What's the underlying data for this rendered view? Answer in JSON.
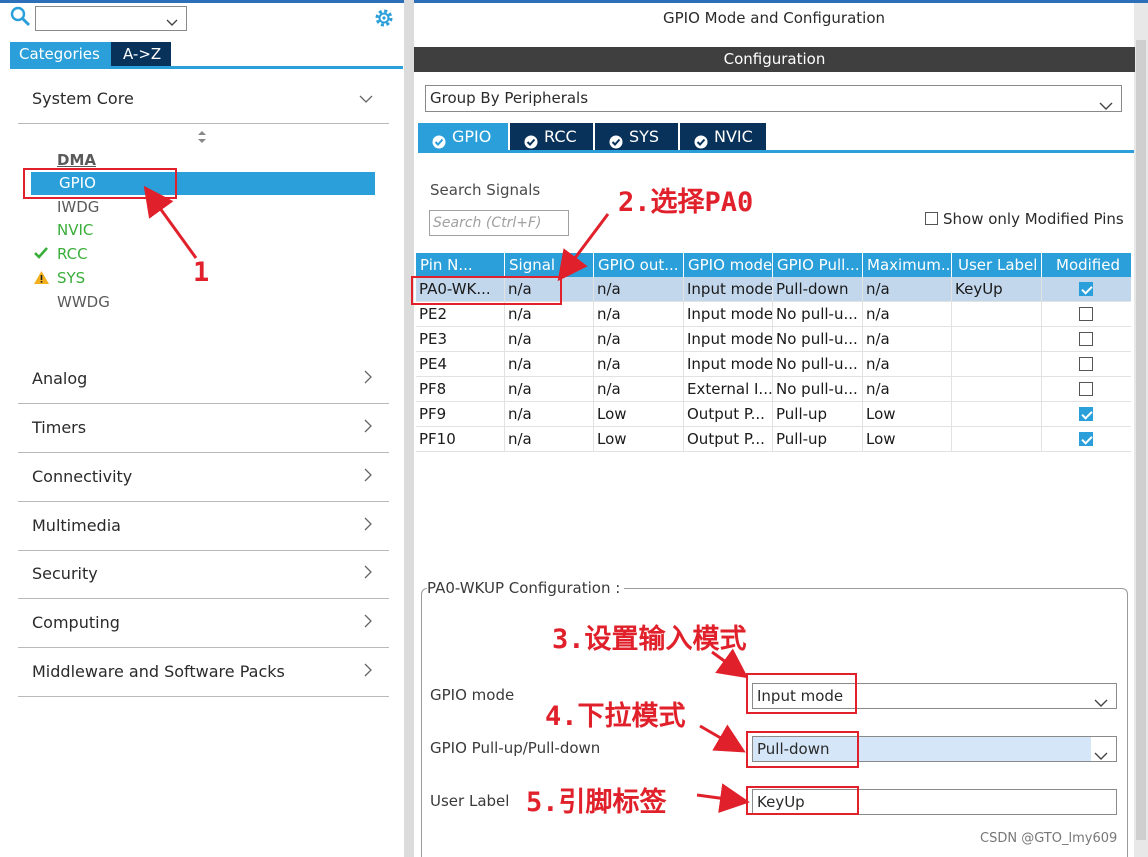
{
  "left": {
    "search_value": "",
    "tabs": [
      "Categories",
      "A->Z"
    ],
    "categories": [
      {
        "label": "System Core",
        "chevron": "chevron-down-icon"
      },
      {
        "label": "Analog",
        "chevron": "chevron-right-icon"
      },
      {
        "label": "Timers",
        "chevron": "chevron-right-icon"
      },
      {
        "label": "Connectivity",
        "chevron": "chevron-right-icon"
      },
      {
        "label": "Multimedia",
        "chevron": "chevron-right-icon"
      },
      {
        "label": "Security",
        "chevron": "chevron-right-icon"
      },
      {
        "label": "Computing",
        "chevron": "chevron-right-icon"
      },
      {
        "label": "Middleware and Software Packs",
        "chevron": "chevron-right-icon"
      }
    ],
    "system_core_items": [
      {
        "label": "DMA",
        "status": "none"
      },
      {
        "label": "GPIO",
        "status": "selected"
      },
      {
        "label": "IWDG",
        "status": "none"
      },
      {
        "label": "NVIC",
        "status": "configured"
      },
      {
        "label": "RCC",
        "status": "check"
      },
      {
        "label": "SYS",
        "status": "warning"
      },
      {
        "label": "WWDG",
        "status": "none"
      }
    ]
  },
  "right": {
    "title": "GPIO Mode and Configuration",
    "config_header": "Configuration",
    "group_by": "Group By Peripherals",
    "tabs": [
      "GPIO",
      "RCC",
      "SYS",
      "NVIC"
    ],
    "active_tab": "GPIO",
    "search_label": "Search Signals",
    "search_placeholder": "Search (Ctrl+F)",
    "show_modified_label": "Show only Modified Pins",
    "show_modified_checked": false,
    "table": {
      "headers": [
        "Pin N...",
        "Signal ...",
        "GPIO out...",
        "GPIO mode",
        "GPIO Pull...",
        "Maximum...",
        "User Label",
        "Modified"
      ],
      "rows": [
        {
          "cells": [
            "PA0-WK...",
            "n/a",
            "n/a",
            "Input mode",
            "Pull-down",
            "n/a",
            "KeyUp"
          ],
          "modified": true,
          "selected": true
        },
        {
          "cells": [
            "PE2",
            "n/a",
            "n/a",
            "Input mode",
            "No pull-u...",
            "n/a",
            ""
          ],
          "modified": false,
          "selected": false
        },
        {
          "cells": [
            "PE3",
            "n/a",
            "n/a",
            "Input mode",
            "No pull-u...",
            "n/a",
            ""
          ],
          "modified": false,
          "selected": false
        },
        {
          "cells": [
            "PE4",
            "n/a",
            "n/a",
            "Input mode",
            "No pull-u...",
            "n/a",
            ""
          ],
          "modified": false,
          "selected": false
        },
        {
          "cells": [
            "PF8",
            "n/a",
            "n/a",
            "External I...",
            "No pull-u...",
            "n/a",
            ""
          ],
          "modified": false,
          "selected": false
        },
        {
          "cells": [
            "PF9",
            "n/a",
            "Low",
            "Output P...",
            "Pull-up",
            "Low",
            ""
          ],
          "modified": true,
          "selected": false
        },
        {
          "cells": [
            "PF10",
            "n/a",
            "Low",
            "Output P...",
            "Pull-up",
            "Low",
            ""
          ],
          "modified": true,
          "selected": false
        }
      ]
    },
    "pin_config": {
      "title": "PA0-WKUP Configuration :",
      "gpio_mode_label": "GPIO mode",
      "gpio_mode_value": "Input mode",
      "pull_label": "GPIO Pull-up/Pull-down",
      "pull_value": "Pull-down",
      "user_label_label": "User Label",
      "user_label_value": "KeyUp"
    }
  },
  "annotations": {
    "a1": "1",
    "a2": "2.选择PA0",
    "a3": "3.设置输入模式",
    "a4": "4.下拉模式",
    "a5": "5.引脚标签",
    "color": "#e0202a"
  },
  "watermark": "CSDN @GTO_lmy609",
  "colors": {
    "accent": "#2b9fd9",
    "dark_tab": "#09325a",
    "header_bar": "#3f3f3f",
    "ok_green": "#3aae3a"
  }
}
